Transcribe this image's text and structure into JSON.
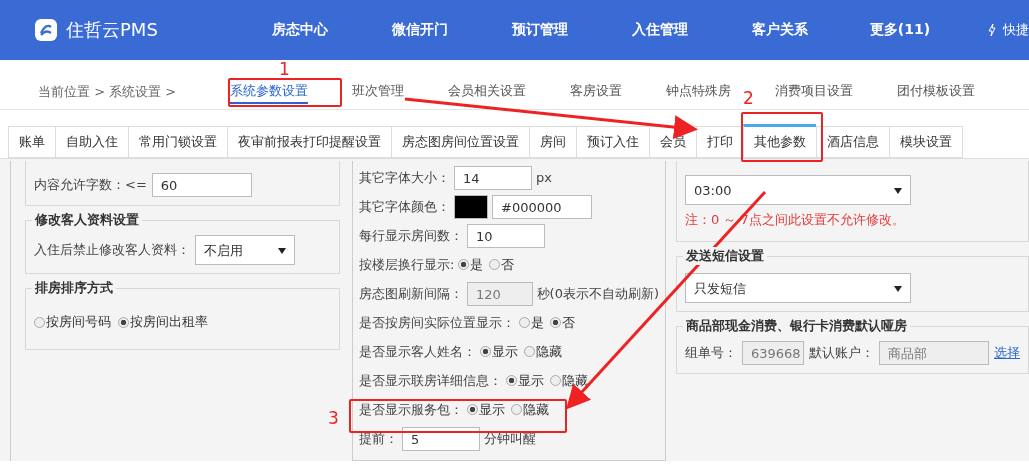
{
  "header": {
    "brand": "住哲云PMS",
    "nav": [
      {
        "label": "房态中心"
      },
      {
        "label": "微信开门"
      },
      {
        "label": "预订管理"
      },
      {
        "label": "入住管理"
      },
      {
        "label": "客户关系"
      },
      {
        "label": "更多(11)"
      }
    ],
    "shortcut": "快捷"
  },
  "breadcrumb": {
    "label": "当前位置 > 系统设置 >"
  },
  "sub_tabs": [
    {
      "label": "系统参数设置",
      "selected": true
    },
    {
      "label": "班次管理",
      "selected": false
    },
    {
      "label": "会员相关设置",
      "selected": false
    },
    {
      "label": "客房设置",
      "selected": false
    },
    {
      "label": "钟点特殊房",
      "selected": false
    },
    {
      "label": "消费项目设置",
      "selected": false
    },
    {
      "label": "团付模板设置",
      "selected": false
    }
  ],
  "tabs": [
    {
      "label": "账单",
      "selected": false
    },
    {
      "label": "自助入住",
      "selected": false
    },
    {
      "label": "常用门锁设置",
      "selected": false
    },
    {
      "label": "夜审前报表打印提醒设置",
      "selected": false
    },
    {
      "label": "房态图房间位置设置",
      "selected": false
    },
    {
      "label": "房间",
      "selected": false
    },
    {
      "label": "预订入住",
      "selected": false
    },
    {
      "label": "会员",
      "selected": false
    },
    {
      "label": "打印",
      "selected": false
    },
    {
      "label": "其他参数",
      "selected": true
    },
    {
      "label": "酒店信息",
      "selected": false
    },
    {
      "label": "模块设置",
      "selected": false
    }
  ],
  "left": {
    "length_row": {
      "label": "内容允许字数：<=",
      "value": "60"
    },
    "groups": [
      {
        "title": "修改客人资料设置",
        "kind": "select",
        "label": "入住后禁止修改客人资料：",
        "value": "不启用"
      },
      {
        "title": "排房排序方式",
        "kind": "radio",
        "options": [
          {
            "label": "按房间号码",
            "selected": false
          },
          {
            "label": "按房间出租率",
            "selected": true
          }
        ]
      }
    ]
  },
  "middle": [
    {
      "kind": "input",
      "label": "其它字体大小：",
      "value": "14",
      "suffix": "px",
      "disabled": false
    },
    {
      "kind": "color",
      "label": "其它字体颜色：",
      "color": "#000000",
      "value": "#000000"
    },
    {
      "kind": "input",
      "label": "每行显示房间数：",
      "value": "10",
      "disabled": false
    },
    {
      "kind": "radio",
      "label": "按楼层换行显示:",
      "options": [
        {
          "label": "是",
          "selected": true
        },
        {
          "label": "否",
          "selected": false
        }
      ]
    },
    {
      "kind": "input",
      "label": "房态图刷新间隔：",
      "value": "120",
      "suffix": "秒(0表示不自动刷新)",
      "disabled": true
    },
    {
      "kind": "radio",
      "label": "是否按房间实际位置显示：",
      "options": [
        {
          "label": "是",
          "selected": false
        },
        {
          "label": "否",
          "selected": true
        }
      ]
    },
    {
      "kind": "radio",
      "label": "是否显示客人姓名：",
      "options": [
        {
          "label": "显示",
          "selected": true
        },
        {
          "label": "隐藏",
          "selected": false
        }
      ]
    },
    {
      "kind": "radio",
      "label": "是否显示联房详细信息：",
      "options": [
        {
          "label": "显示",
          "selected": true
        },
        {
          "label": "隐藏",
          "selected": false
        }
      ]
    },
    {
      "kind": "radio",
      "label": "是否显示服务包：",
      "options": [
        {
          "label": "显示",
          "selected": true
        },
        {
          "label": "隐藏",
          "selected": false
        }
      ]
    },
    {
      "kind": "input",
      "label": "提前：",
      "value": "5",
      "suffix": "分钟叫醒",
      "disabled": false
    }
  ],
  "right": {
    "time_select": "03:00",
    "note": "注：0 ～ 7点之间此设置不允许修改。",
    "sms": {
      "title": "发送短信设置",
      "value": "只发短信"
    },
    "shop": {
      "title": "商品部现金消费、银行卡消费默认哑房",
      "group_label": "组单号：",
      "group_value": "639668",
      "account_label": "默认账户：",
      "account_value": "商品部",
      "link": "选择"
    }
  },
  "annotations": [
    "1",
    "2",
    "3"
  ]
}
